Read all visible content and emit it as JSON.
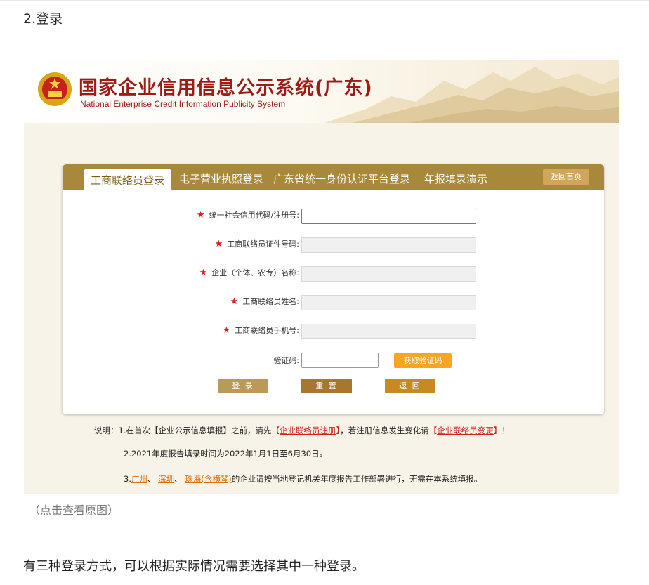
{
  "section_title": "2.登录",
  "site": {
    "title": "国家企业信用信息公示系统(广东)",
    "subtitle": "National Enterprise Credit Information Publicity System"
  },
  "tabs": [
    {
      "label": "工商联络员登录",
      "active": true
    },
    {
      "label": "电子营业执照登录",
      "active": false
    },
    {
      "label": "广东省统一身份认证平台登录",
      "active": false
    },
    {
      "label": "年报填录演示",
      "active": false
    }
  ],
  "home_button": "返回首页",
  "form": {
    "fields": [
      {
        "label": "统一社会信用代码/注册号:",
        "required": true,
        "value": ""
      },
      {
        "label": "工商联络员证件号码:",
        "required": true,
        "value": ""
      },
      {
        "label": "企业（个体、农专）名称:",
        "required": true,
        "value": ""
      },
      {
        "label": "工商联络员姓名:",
        "required": true,
        "value": ""
      },
      {
        "label": "工商联络员手机号:",
        "required": true,
        "value": ""
      }
    ],
    "required_mark": "★",
    "captcha_label": "验证码:",
    "captcha_value": "",
    "get_code_button": "获取验证码",
    "login_button": "登 录",
    "reset_button": "重 置",
    "back_button": "返 回"
  },
  "notes": {
    "line1_prefix": "说明：1.在首次【企业公示信息填报】之前，请先",
    "line1_bracket_open": "【",
    "line1_link1": "企业联络员注册",
    "line1_bracket_close": "】",
    "line1_middle": "，若注册信息发生变化请",
    "line1_link2": "企业联络员变更",
    "line1_end": "！",
    "line2": "2.2021年度报告填录时间为2022年1月1日至6月30日。",
    "line3_prefix": "3.",
    "line3_city1": "广州",
    "line3_sep1": "、",
    "line3_city2": "深圳",
    "line3_sep2": "、",
    "line3_city3": "珠海(含横琴)",
    "line3_suffix": "的企业请按当地登记机关年度报告工作部署进行，无需在本系统填报。"
  },
  "caption": "（点击查看原图）",
  "paragraph": "有三种登录方式，可以根据实际情况需要选择其中一种登录。",
  "colors": {
    "tab_bar": "#a8893c",
    "home_button": "#cfa65a",
    "get_code": "#f6a623",
    "login": "#b99a57",
    "reset": "#a8762c",
    "back": "#c78a22",
    "title_red": "#9e1b16",
    "required_red": "#d62020"
  }
}
